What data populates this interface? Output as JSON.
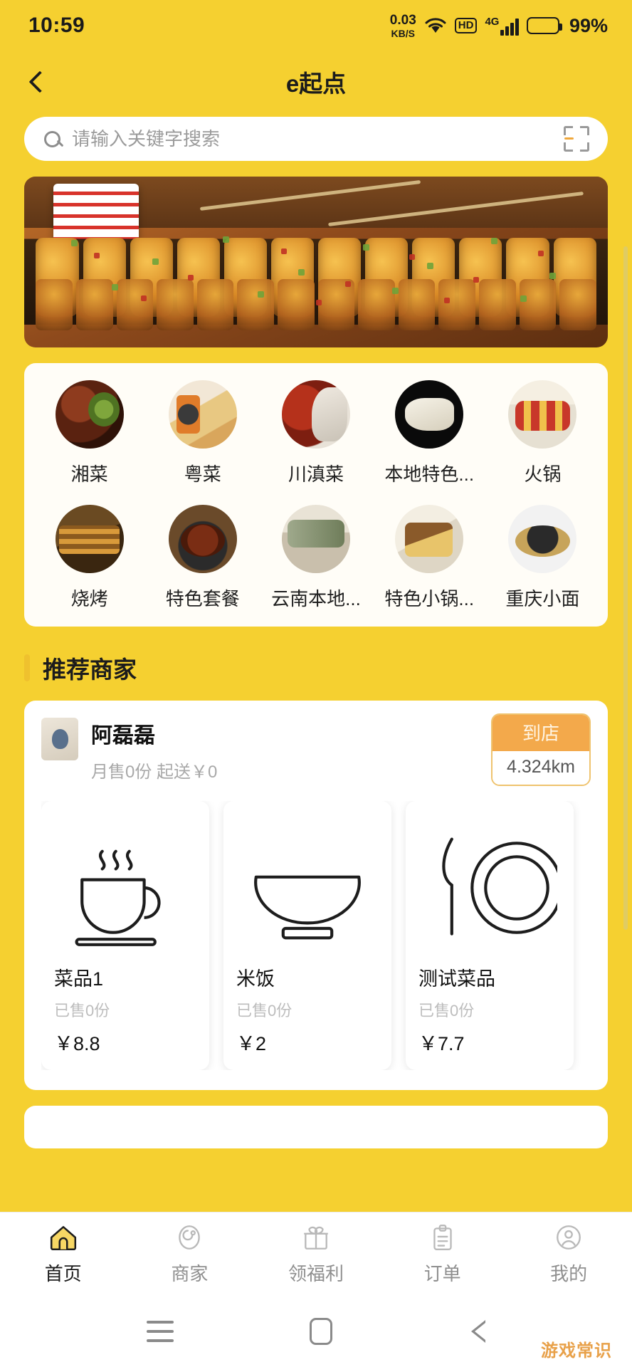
{
  "theme": {
    "brand_yellow": "#F5D030",
    "accent_orange": "#F3A94B",
    "accent_bar": "#EFC12E"
  },
  "status_bar": {
    "time": "10:59",
    "net_speed_value": "0.03",
    "net_speed_unit": "KB/S",
    "wifi_icon": "wifi-icon",
    "hd_label": "HD",
    "network_type": "4G",
    "signal_icon": "signal-bars-icon",
    "battery_icon": "battery-icon",
    "battery_percent": "99%"
  },
  "appbar": {
    "back_icon": "back-chevron-icon",
    "title": "e起点"
  },
  "search": {
    "search_icon": "search-icon",
    "placeholder": "请输入关键字搜索",
    "value": "",
    "scan_icon": "scan-code-icon"
  },
  "banner": {
    "alt_name": "promo-banner-food-grill"
  },
  "categories": [
    {
      "label": "湘菜",
      "thumb": "t1"
    },
    {
      "label": "粤菜",
      "thumb": "t2"
    },
    {
      "label": "川滇菜",
      "thumb": "t3"
    },
    {
      "label": "本地特色...",
      "thumb": "t4"
    },
    {
      "label": "火锅",
      "thumb": "t5"
    },
    {
      "label": "烧烤",
      "thumb": "t6"
    },
    {
      "label": "特色套餐",
      "thumb": "t7"
    },
    {
      "label": "云南本地...",
      "thumb": "t8"
    },
    {
      "label": "特色小锅...",
      "thumb": "t9"
    },
    {
      "label": "重庆小面",
      "thumb": "t10"
    }
  ],
  "section": {
    "recommended_title": "推荐商家"
  },
  "merchant": {
    "logo_name": "merchant-logo",
    "name": "阿磊磊",
    "subtitle": "月售0份  起送￥0",
    "badge_top": "到店",
    "badge_distance": "4.324km",
    "dishes": [
      {
        "name": "菜品1",
        "sold": "已售0份",
        "price": "￥8.8",
        "icon": "coffee-cup-icon"
      },
      {
        "name": "米饭",
        "sold": "已售0份",
        "price": "￥2",
        "icon": "rice-bowl-icon"
      },
      {
        "name": "测试菜品",
        "sold": "已售0份",
        "price": "￥7.7",
        "icon": "plate-knife-icon"
      }
    ]
  },
  "tabbar": [
    {
      "label": "首页",
      "icon": "home-icon",
      "active": true
    },
    {
      "label": "商家",
      "icon": "shop-icon",
      "active": false
    },
    {
      "label": "领福利",
      "icon": "gift-icon",
      "active": false
    },
    {
      "label": "订单",
      "icon": "clipboard-icon",
      "active": false
    },
    {
      "label": "我的",
      "icon": "user-icon",
      "active": false
    }
  ],
  "system_nav": {
    "menu_icon": "menu-icon",
    "home_icon": "home-square-icon",
    "back_icon": "back-triangle-icon",
    "watermark": "游戏常识"
  }
}
